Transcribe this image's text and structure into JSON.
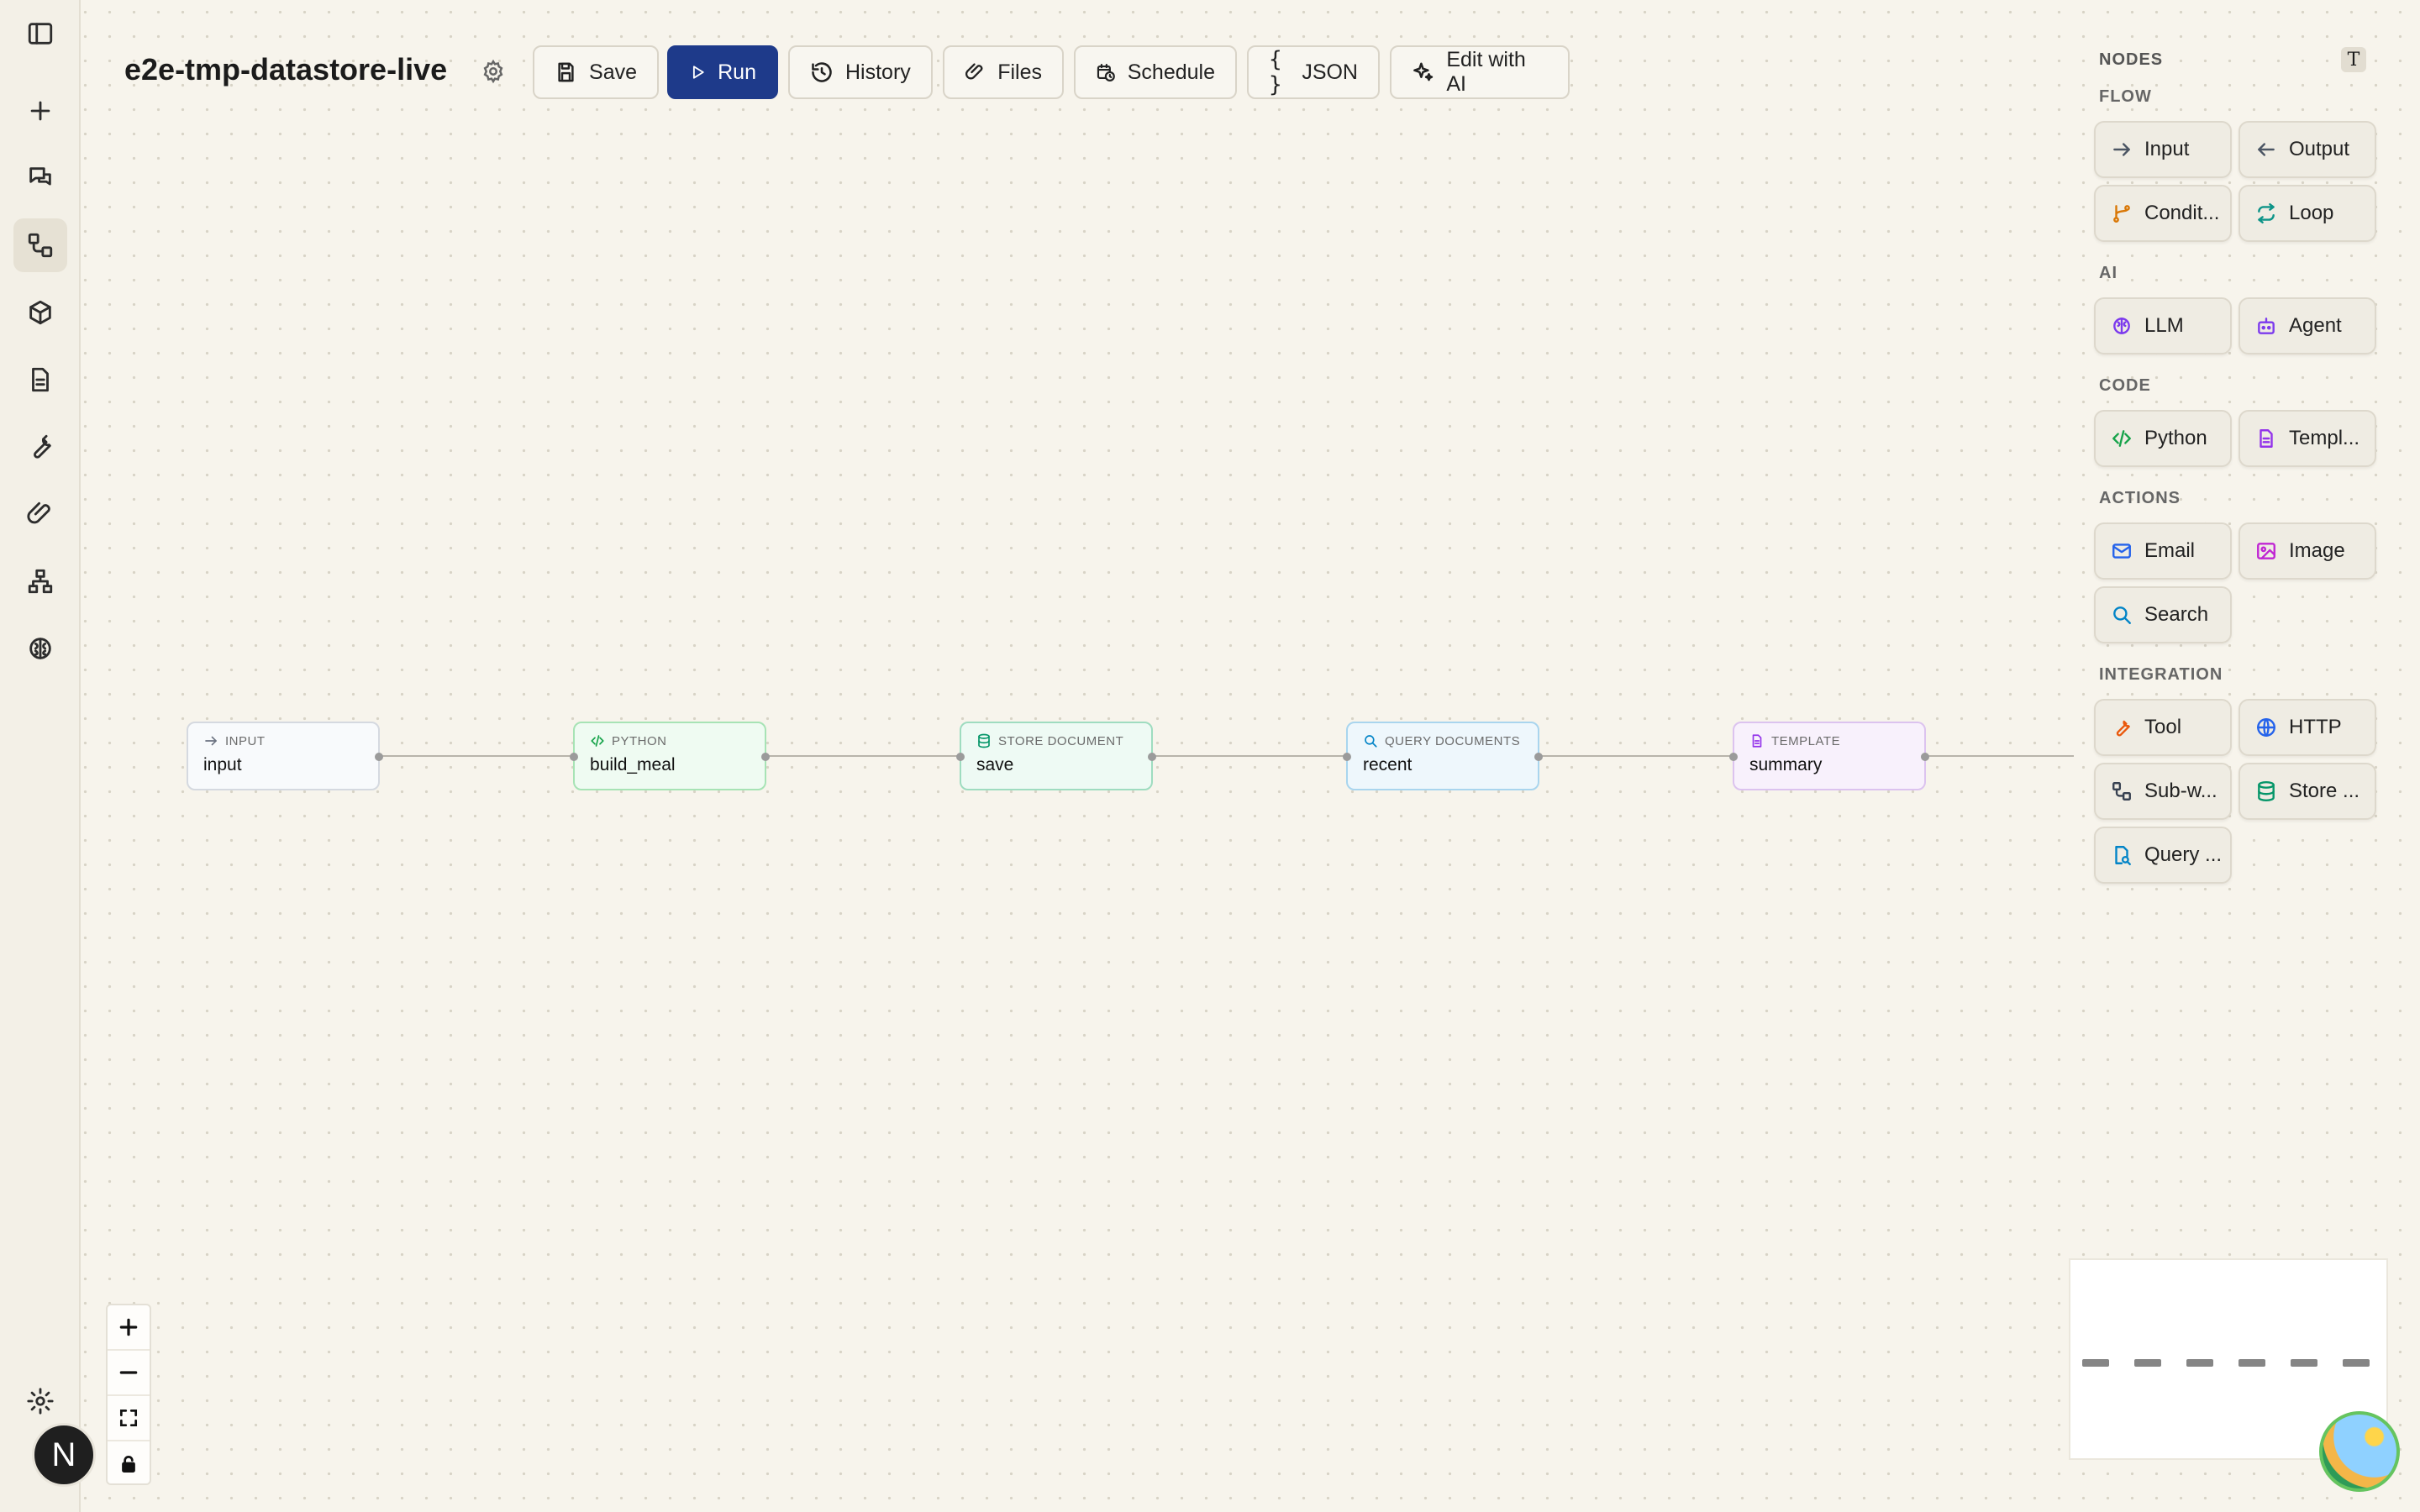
{
  "workflow": {
    "title": "e2e-tmp-datastore-live"
  },
  "toolbar": {
    "save": "Save",
    "run": "Run",
    "history": "History",
    "files": "Files",
    "schedule": "Schedule",
    "json": "JSON",
    "edit_ai": "Edit with AI"
  },
  "nodes": [
    {
      "kind": "INPUT",
      "name": "input",
      "color": "#6b7280",
      "icon": "arrow-right-icon"
    },
    {
      "kind": "PYTHON",
      "name": "build_meal",
      "color": "#16a34a",
      "icon": "code-icon"
    },
    {
      "kind": "STORE DOCUMENT",
      "name": "save",
      "color": "#059669",
      "icon": "database-icon"
    },
    {
      "kind": "QUERY DOCUMENTS",
      "name": "recent",
      "color": "#0284c7",
      "icon": "search-icon"
    },
    {
      "kind": "TEMPLATE",
      "name": "summary",
      "color": "#9333ea",
      "icon": "file-icon"
    }
  ],
  "panel": {
    "title": "NODES",
    "t_badge": "T",
    "sections": {
      "flow": "FLOW",
      "ai": "AI",
      "code": "CODE",
      "actions": "ACTIONS",
      "integration": "INTEGRATION"
    },
    "items": {
      "input": "Input",
      "output": "Output",
      "condition": "Condit...",
      "loop": "Loop",
      "llm": "LLM",
      "agent": "Agent",
      "python": "Python",
      "template": "Templ...",
      "email": "Email",
      "image": "Image",
      "search": "Search",
      "tool": "Tool",
      "http": "HTTP",
      "subworkflow": "Sub-w...",
      "store": "Store ...",
      "query": "Query ..."
    }
  },
  "user": {
    "avatar_letter": "N"
  },
  "colors": {
    "primary": "#1e3a8a",
    "background": "#f7f4ec"
  }
}
